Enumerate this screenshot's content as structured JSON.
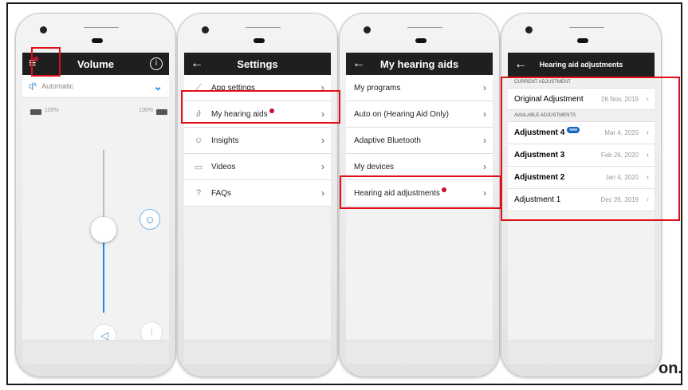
{
  "phone1": {
    "title": "Volume",
    "info_glyph": "i",
    "mode_label": "Automatic",
    "left_level": "100%",
    "right_level": "100%",
    "slider_level_fraction": 0.53
  },
  "phone2": {
    "title": "Settings",
    "items": [
      {
        "label": "App settings",
        "icon": "wrench-icon"
      },
      {
        "label": "My hearing aids",
        "icon": "hearing-aid-icon"
      },
      {
        "label": "Insights",
        "icon": "smiley-icon"
      },
      {
        "label": "Videos",
        "icon": "video-icon"
      },
      {
        "label": "FAQs",
        "icon": "question-icon"
      }
    ]
  },
  "phone3": {
    "title": "My hearing aids",
    "items": [
      {
        "label": "My programs"
      },
      {
        "label": "Auto on (Hearing Aid Only)"
      },
      {
        "label": "Adaptive Bluetooth"
      },
      {
        "label": "My devices"
      },
      {
        "label": "Hearing aid adjustments"
      }
    ]
  },
  "phone4": {
    "title": "Hearing aid adjustments",
    "current_header": "CURRENT ADJUSTMENT",
    "current": {
      "label": "Original Adjustment",
      "date": "26 Nov, 2019"
    },
    "available_header": "AVAILABLE ADJUSTMENTS",
    "new_badge": "new",
    "available": [
      {
        "label": "Adjustment 4",
        "date": "Mar 4, 2020"
      },
      {
        "label": "Adjustment 3",
        "date": "Feb 26, 2020"
      },
      {
        "label": "Adjustment 2",
        "date": "Jan 4, 2020"
      },
      {
        "label": "Adjustment 1",
        "date": "Dec 26, 2019"
      }
    ]
  },
  "colors": {
    "highlight": "#e0101a",
    "accent": "#1e88e5",
    "dot": "#c8102e",
    "bar": "#1f1f1f"
  },
  "corner_text": "on."
}
